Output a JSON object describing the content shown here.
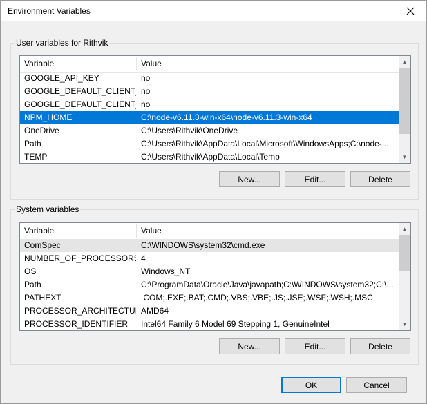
{
  "window": {
    "title": "Environment Variables"
  },
  "user": {
    "group_label": "User variables for Rithvik",
    "columns": [
      "Variable",
      "Value"
    ],
    "rows": [
      {
        "name": "GOOGLE_API_KEY",
        "value": "no"
      },
      {
        "name": "GOOGLE_DEFAULT_CLIENT_ID",
        "value": "no"
      },
      {
        "name": "GOOGLE_DEFAULT_CLIENT_...",
        "value": "no"
      },
      {
        "name": "NPM_HOME",
        "value": "C:\\node-v6.11.3-win-x64\\node-v6.11.3-win-x64"
      },
      {
        "name": "OneDrive",
        "value": "C:\\Users\\Rithvik\\OneDrive"
      },
      {
        "name": "Path",
        "value": "C:\\Users\\Rithvik\\AppData\\Local\\Microsoft\\WindowsApps;C:\\node-..."
      },
      {
        "name": "TEMP",
        "value": "C:\\Users\\Rithvik\\AppData\\Local\\Temp"
      }
    ],
    "buttons": {
      "new": "New...",
      "edit": "Edit...",
      "delete": "Delete"
    }
  },
  "system": {
    "group_label": "System variables",
    "columns": [
      "Variable",
      "Value"
    ],
    "rows": [
      {
        "name": "ComSpec",
        "value": "C:\\WINDOWS\\system32\\cmd.exe"
      },
      {
        "name": "NUMBER_OF_PROCESSORS",
        "value": "4"
      },
      {
        "name": "OS",
        "value": "Windows_NT"
      },
      {
        "name": "Path",
        "value": "C:\\ProgramData\\Oracle\\Java\\javapath;C:\\WINDOWS\\system32;C:\\..."
      },
      {
        "name": "PATHEXT",
        "value": ".COM;.EXE;.BAT;.CMD;.VBS;.VBE;.JS;.JSE;.WSF;.WSH;.MSC"
      },
      {
        "name": "PROCESSOR_ARCHITECTURE",
        "value": "AMD64"
      },
      {
        "name": "PROCESSOR_IDENTIFIER",
        "value": "Intel64 Family 6 Model 69 Stepping 1, GenuineIntel"
      }
    ],
    "buttons": {
      "new": "New...",
      "edit": "Edit...",
      "delete": "Delete"
    }
  },
  "footer": {
    "ok": "OK",
    "cancel": "Cancel"
  },
  "colors": {
    "selection": "#0078d7",
    "hover": "#e5e5e5"
  },
  "icons": {
    "close": "close-icon",
    "scroll_up": "scroll-up-arrow-icon",
    "scroll_down": "scroll-down-arrow-icon"
  }
}
